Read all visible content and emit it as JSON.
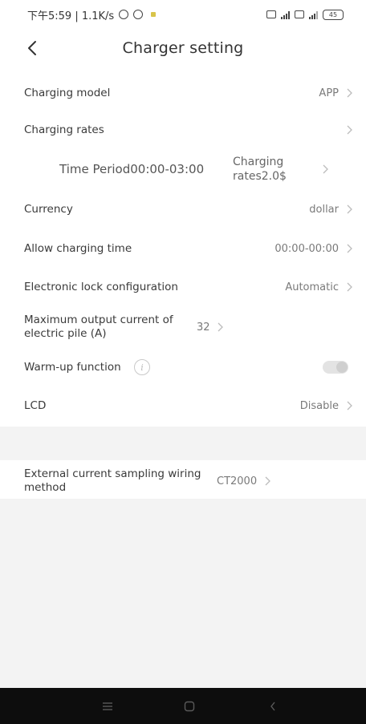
{
  "status_bar": {
    "time_info": "下午5:59 | 1.1K/s",
    "battery": "45"
  },
  "header": {
    "title": "Charger setting"
  },
  "settings": {
    "charging_model": {
      "label": "Charging model",
      "value": "APP"
    },
    "charging_rates": {
      "label": "Charging rates"
    },
    "rate_entry": {
      "period": "Time Period00:00-03:00",
      "rate": "Charging rates2.0$"
    },
    "currency": {
      "label": "Currency",
      "value": "dollar"
    },
    "allow_charging_time": {
      "label": "Allow charging time",
      "value": "00:00-00:00"
    },
    "electronic_lock": {
      "label": "Electronic lock configuration",
      "value": "Automatic"
    },
    "max_output_current": {
      "label": "Maximum output current of electric pile (A)",
      "value": "32"
    },
    "warmup": {
      "label": "Warm-up function",
      "info_glyph": "i",
      "enabled": false
    },
    "lcd": {
      "label": "LCD",
      "value": "Disable"
    },
    "external_sampling": {
      "label": "External current sampling wiring method",
      "value": "CT2000"
    }
  },
  "icons": {
    "back": "chevron-left-icon",
    "row_arrow": "chevron-right-icon",
    "nav_menu": "menu-icon",
    "nav_home": "home-icon",
    "nav_back": "back-icon"
  },
  "colors": {
    "background": "#ffffff",
    "band": "#f3f3f3",
    "nav_bar": "#0d0d0d",
    "text": "#3a3a3a",
    "secondary_text": "#7a7a7a"
  }
}
